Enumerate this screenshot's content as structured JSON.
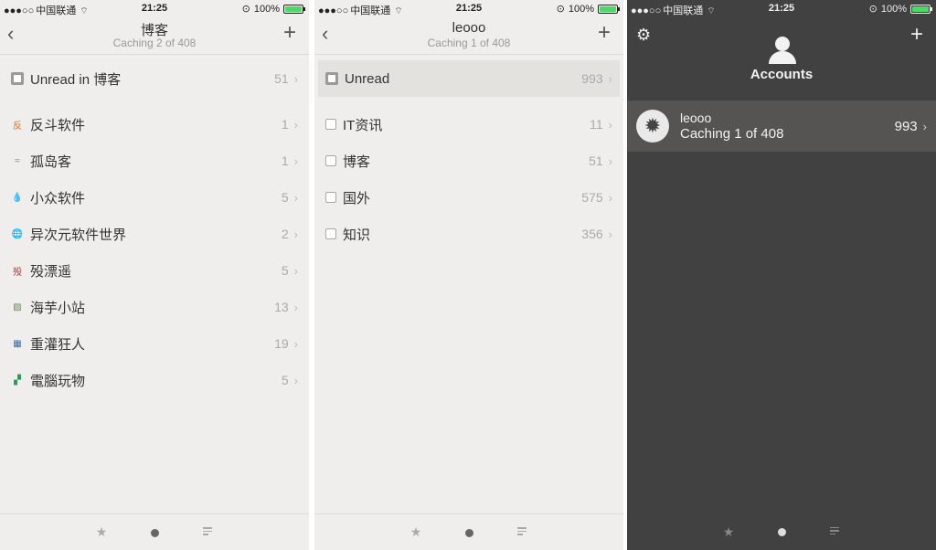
{
  "status": {
    "signal": "●●●○○",
    "carrier": "中国联通",
    "time": "21:25",
    "battery": "100%"
  },
  "panel1": {
    "title": "博客",
    "subtitle": "Caching 2 of 408",
    "items": [
      {
        "label": "Unread in 博客",
        "count": "51",
        "icon": "unread-square-icon"
      },
      {
        "label": "反斗软件",
        "count": "1",
        "icon": "fandou-favicon-icon",
        "glyph": "反",
        "color": "#e0702a"
      },
      {
        "label": "孤岛客",
        "count": "1",
        "icon": "rss-feed-icon",
        "glyph": "≈",
        "color": "#888888"
      },
      {
        "label": "小众软件",
        "count": "5",
        "icon": "drop-favicon-icon",
        "glyph": "💧",
        "color": "#2a7fd4"
      },
      {
        "label": "异次元软件世界",
        "count": "2",
        "icon": "globe-favicon-icon",
        "glyph": "🌐",
        "color": "#3a8fd0"
      },
      {
        "label": "殁漂遥",
        "count": "5",
        "icon": "mopiaoyao-favicon-icon",
        "glyph": "殁",
        "color": "#d42a2a"
      },
      {
        "label": "海芋小站",
        "count": "13",
        "icon": "landscape-favicon-icon",
        "glyph": "▨",
        "color": "#6a8a4a"
      },
      {
        "label": "重灌狂人",
        "count": "19",
        "icon": "chong-favicon-icon",
        "glyph": "▦",
        "color": "#3a6ab0"
      },
      {
        "label": "電腦玩物",
        "count": "5",
        "icon": "playpc-favicon-icon",
        "glyph": "▞",
        "color": "#2a9a5a"
      }
    ]
  },
  "panel2": {
    "title": "leooo",
    "subtitle": "Caching 1 of 408",
    "items": [
      {
        "label": "Unread",
        "count": "993"
      },
      {
        "label": "IT资讯",
        "count": "11"
      },
      {
        "label": "博客",
        "count": "51"
      },
      {
        "label": "国外",
        "count": "575"
      },
      {
        "label": "知识",
        "count": "356"
      }
    ]
  },
  "panel3": {
    "title": "Accounts",
    "account": {
      "name": "leooo",
      "subtitle": "Caching 1 of 408",
      "count": "993"
    }
  },
  "tabs": [
    "starred",
    "unread",
    "all"
  ],
  "icons": {
    "back": "‹",
    "plus": "+",
    "chevron": "›",
    "star": "★",
    "gear": "⚙"
  }
}
